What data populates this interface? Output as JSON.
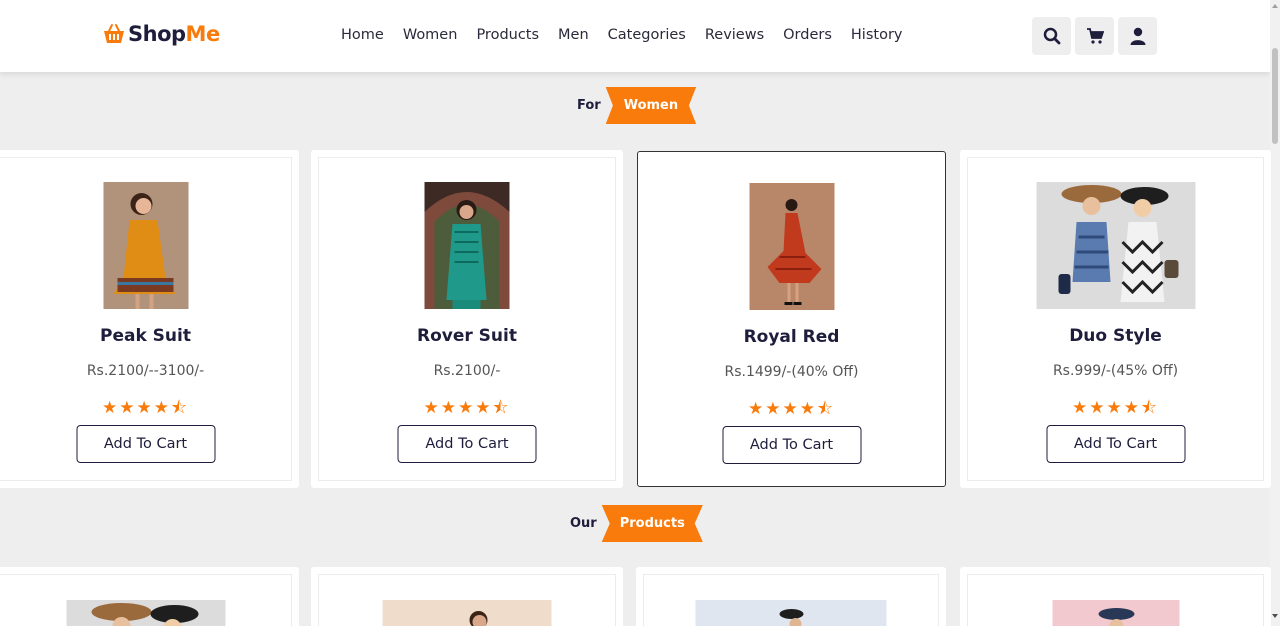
{
  "brand": {
    "part1": "Shop",
    "part2": "Me"
  },
  "nav": [
    "Home",
    "Women",
    "Products",
    "Men",
    "Categories",
    "Reviews",
    "Orders",
    "History"
  ],
  "header_icons": [
    "search-icon",
    "cart-icon",
    "user-icon"
  ],
  "section_women": {
    "pre": "For",
    "tag": "Women"
  },
  "section_products": {
    "pre": "Our",
    "tag": "Products"
  },
  "women_products": [
    {
      "title": "Peak Suit",
      "price": "Rs.2100/--3100/-",
      "rating": 4.5,
      "stars": "★★★★⯪",
      "button": "Add To Cart"
    },
    {
      "title": "Rover Suit",
      "price": "Rs.2100/-",
      "rating": 4.5,
      "stars": "★★★★⯪",
      "button": "Add To Cart"
    },
    {
      "title": "Royal Red",
      "price": "Rs.1499/-(40% Off)",
      "rating": 4.5,
      "stars": "★★★★⯪",
      "button": "Add To Cart"
    },
    {
      "title": "Duo Style",
      "price": "Rs.999/-(45% Off)",
      "rating": 4.5,
      "stars": "★★★★⯪",
      "button": "Add To Cart"
    }
  ],
  "colors": {
    "accent": "#f97b0b",
    "dark": "#1f1d3c",
    "background": "#eeeeee"
  }
}
